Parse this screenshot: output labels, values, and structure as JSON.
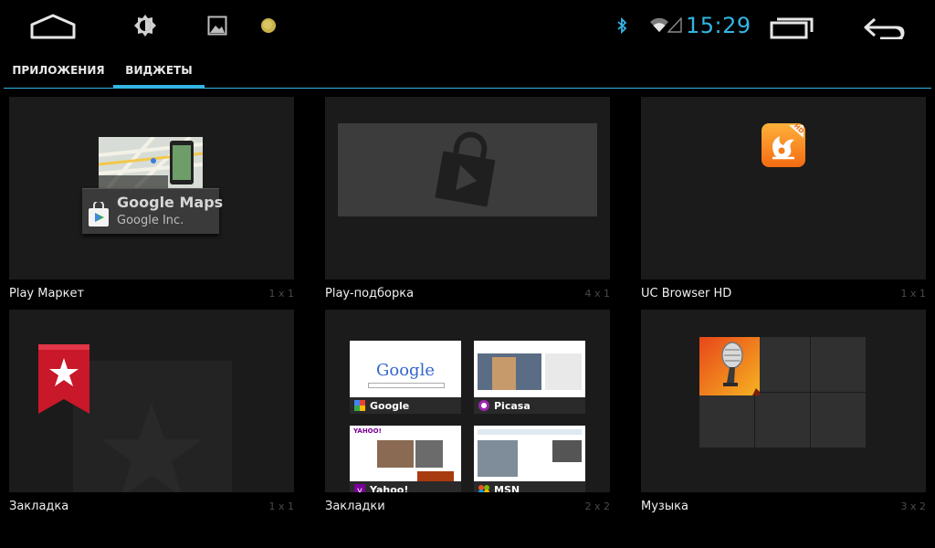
{
  "system_bar": {
    "icons": [
      "home-icon",
      "brightness-icon",
      "gallery-icon",
      "weather-icon",
      "bluetooth-icon",
      "wifi-icon",
      "signal-icon",
      "recent-apps-icon",
      "back-icon"
    ],
    "time": "15:29",
    "accent": "#33b5e5"
  },
  "tabs": [
    {
      "label": "ПРИЛОЖЕНИЯ",
      "active": false
    },
    {
      "label": "ВИДЖЕТЫ",
      "active": true
    }
  ],
  "widgets": [
    {
      "name": "Play Маркет",
      "size": "1 x 1",
      "preview": {
        "app_title": "Google Maps",
        "app_publisher": "Google Inc."
      }
    },
    {
      "name": "Play-подборка",
      "size": "4 x 1"
    },
    {
      "name": "UC Browser HD",
      "size": "1 x 1",
      "badge": "HD"
    },
    {
      "name": "Закладка",
      "size": "1 x 1"
    },
    {
      "name": "Закладки",
      "size": "2 x 2",
      "thumbs": [
        "Google",
        "Picasa",
        "Yahoo!",
        "MSN"
      ],
      "google_logo": "Google"
    },
    {
      "name": "Музыка",
      "size": "3 x 2"
    }
  ]
}
